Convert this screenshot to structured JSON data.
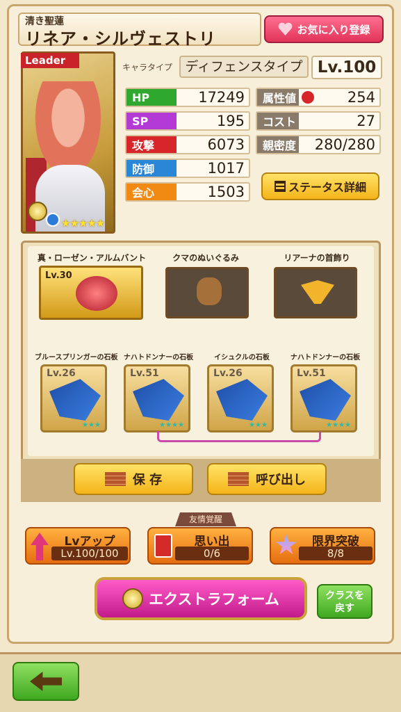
{
  "header": {
    "subtitle": "清き聖蓮",
    "name": "リネア・シルヴェストリ",
    "fav_button": "お気に入り登録"
  },
  "portrait": {
    "leader_tag": "Leader",
    "stars": "★★★★★",
    "star_count": 5
  },
  "profile": {
    "type_label": "キャラタイプ",
    "type_value": "ディフェンスタイプ",
    "level": "Lv.100"
  },
  "stats_left": [
    {
      "label": "HP",
      "value": "17249",
      "color": "#2fa82f"
    },
    {
      "label": "SP",
      "value": "195",
      "color": "#b43ad6"
    },
    {
      "label": "攻撃",
      "value": "6073",
      "color": "#d6262a"
    },
    {
      "label": "防御",
      "value": "1017",
      "color": "#2a86d6"
    },
    {
      "label": "会心",
      "value": "1503",
      "color": "#f08a12"
    }
  ],
  "stats_right": [
    {
      "label": "属性値",
      "value": "254",
      "color": "#8a7a6a"
    },
    {
      "label": "コスト",
      "value": "27",
      "color": "#8a7a6a"
    },
    {
      "label": "親密度",
      "value": "280/280",
      "color": "#8a7a6a"
    }
  ],
  "status_detail_button": "ステータス詳細",
  "equipment": [
    {
      "name": "真・ローゼン・アルムバント",
      "level": "Lv.30"
    },
    {
      "name": "クマのぬいぐるみ",
      "level": ""
    },
    {
      "name": "リアーナの首飾り",
      "level": ""
    }
  ],
  "slabs": [
    {
      "name": "ブルースプリンガーの石板",
      "level": "Lv.26",
      "stars": "★★★"
    },
    {
      "name": "ナハトドンナーの石板",
      "level": "Lv.51",
      "stars": "★★★★"
    },
    {
      "name": "イシュクルの石板",
      "level": "Lv.26",
      "stars": "★★★"
    },
    {
      "name": "ナハトドンナーの石板",
      "level": "Lv.51",
      "stars": "★★★★"
    }
  ],
  "actions": {
    "save": "保 存",
    "recall": "呼び出し"
  },
  "progress": {
    "friend_tag": "友情覚醒",
    "lvup_title": "Lvアップ",
    "lvup_value": "Lv.100/100",
    "memory_title": "思い出",
    "memory_value": "0/6",
    "limit_title": "限界突破",
    "limit_value": "8/8"
  },
  "extra_form_button": "エクストラフォーム",
  "class_return_button": "クラスを\n戻す",
  "back_icon": "left-arrow-icon"
}
